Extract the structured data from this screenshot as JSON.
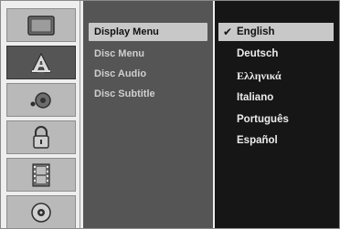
{
  "sidebar": {
    "icons": [
      {
        "name": "tv-icon"
      },
      {
        "name": "language-icon"
      },
      {
        "name": "audio-icon"
      },
      {
        "name": "lock-icon"
      },
      {
        "name": "film-icon"
      },
      {
        "name": "disc-icon"
      }
    ]
  },
  "menu": {
    "items": [
      {
        "label": "Display Menu",
        "selected": true
      },
      {
        "label": "Disc Menu"
      },
      {
        "label": "Disc Audio"
      },
      {
        "label": "Disc Subtitle"
      }
    ]
  },
  "languages": {
    "check_glyph": "✔",
    "items": [
      {
        "label": "English",
        "selected": true
      },
      {
        "label": "Deutsch"
      },
      {
        "label": "Ελληνικά"
      },
      {
        "label": "Italiano"
      },
      {
        "label": "Português"
      },
      {
        "label": "Español"
      }
    ]
  },
  "colors": {
    "background": "#eeeeee",
    "icon_button": "#b9b9b9",
    "icon_active": "#555555",
    "middle_panel": "#555555",
    "right_panel": "#161616",
    "highlight": "#c8c8c8"
  }
}
